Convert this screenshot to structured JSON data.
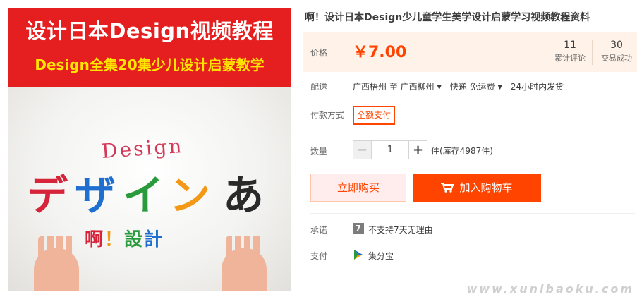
{
  "image": {
    "banner_title": "设计日本Design视频教程",
    "banner_subtitle": "Design全集20集少儿设计启蒙教学",
    "design_word": "Design",
    "kana": [
      "デ",
      "ザ",
      "イ",
      "ン",
      "あ"
    ],
    "kana_colors": [
      "#d6243a",
      "#1f6fd1",
      "#2a9b3c",
      "#f29a18",
      "#2a2a2a"
    ],
    "ah_text": [
      "啊",
      "！",
      "設",
      "計"
    ],
    "ah_colors": [
      "#d6243a",
      "#f29a18",
      "#2a9b3c",
      "#1f6fd1"
    ]
  },
  "product": {
    "title": "啊！设计日本Design少儿童学生美学设计启蒙学习视频教程资料"
  },
  "price": {
    "label": "价格",
    "value": "￥7.00",
    "reviews_count": "11",
    "reviews_label": "累计评论",
    "trades_count": "30",
    "trades_label": "交易成功"
  },
  "shipping": {
    "label": "配送",
    "origin": "广西梧州 至",
    "destination": "广西柳州",
    "method": "快递 免运费",
    "dispatch": "24小时内发货"
  },
  "payment_method": {
    "label": "付款方式",
    "option": "全额支付"
  },
  "quantity": {
    "label": "数量",
    "minus": "−",
    "value": "1",
    "plus": "+",
    "stock": "件(库存4987件)"
  },
  "actions": {
    "buy_now": "立即购买",
    "add_to_cart": "加入购物车"
  },
  "promise": {
    "label": "承诺",
    "icon_glyph": "7",
    "text": "不支持7天无理由"
  },
  "pay": {
    "label": "支付",
    "text": "集分宝"
  },
  "watermark": "www.xunibaoku.com",
  "colors": {
    "accent": "#ff4400",
    "price_bg": "#fff2e8",
    "banner_red": "#e51f1f",
    "banner_yellow": "#ffe600"
  }
}
